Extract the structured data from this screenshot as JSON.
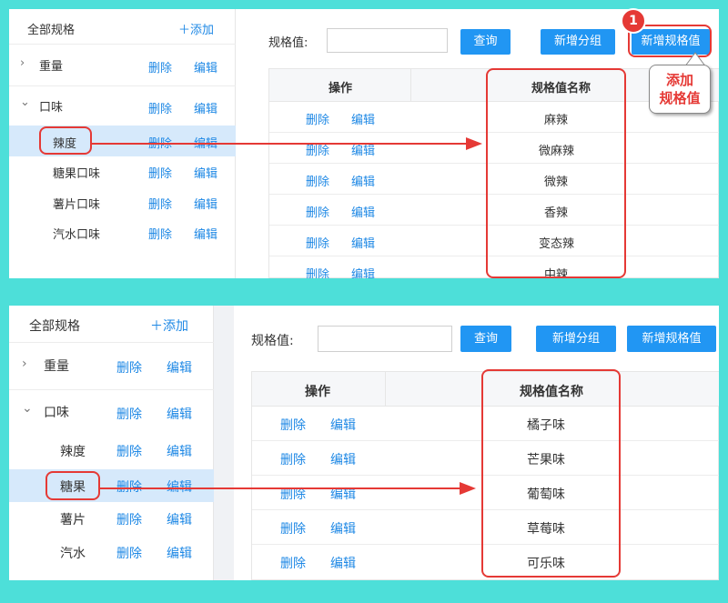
{
  "top": {
    "sidebar": {
      "header": "全部规格",
      "add": "添加",
      "rows": [
        {
          "label": "重量",
          "expand": "›",
          "del": "删除",
          "edit": "编辑"
        },
        {
          "label": "口味",
          "expand": "⌄",
          "del": "删除",
          "edit": "编辑"
        },
        {
          "label": "辣度",
          "del": "删除",
          "edit": "编辑"
        },
        {
          "label": "糖果口味",
          "del": "删除",
          "edit": "编辑"
        },
        {
          "label": "薯片口味",
          "del": "删除",
          "edit": "编辑"
        },
        {
          "label": "汽水口味",
          "del": "删除",
          "edit": "编辑"
        }
      ]
    },
    "toolbar": {
      "label": "规格值:",
      "input_value": "",
      "query": "查询",
      "new_group": "新增分组",
      "new_value": "新增规格值"
    },
    "table": {
      "col_ops": "操作",
      "col_name": "规格值名称",
      "rows": [
        {
          "del": "删除",
          "edit": "编辑",
          "name": "麻辣"
        },
        {
          "del": "删除",
          "edit": "编辑",
          "name": "微麻辣"
        },
        {
          "del": "删除",
          "edit": "编辑",
          "name": "微辣"
        },
        {
          "del": "删除",
          "edit": "编辑",
          "name": "香辣"
        },
        {
          "del": "删除",
          "edit": "编辑",
          "name": "变态辣"
        },
        {
          "del": "删除",
          "edit": "编辑",
          "name": "中辣"
        }
      ]
    },
    "annotation": {
      "badge": "1",
      "callout_line1": "添加",
      "callout_line2": "规格值"
    }
  },
  "bottom": {
    "sidebar": {
      "header": "全部规格",
      "add": "添加",
      "rows": [
        {
          "label": "重量",
          "expand": "›",
          "del": "删除",
          "edit": "编辑"
        },
        {
          "label": "口味",
          "expand": "⌄",
          "del": "删除",
          "edit": "编辑"
        },
        {
          "label": "辣度",
          "del": "删除",
          "edit": "编辑"
        },
        {
          "label": "糖果",
          "del": "删除",
          "edit": "编辑"
        },
        {
          "label": "薯片",
          "del": "删除",
          "edit": "编辑"
        },
        {
          "label": "汽水",
          "del": "删除",
          "edit": "编辑"
        }
      ]
    },
    "toolbar": {
      "label": "规格值:",
      "input_value": "",
      "query": "查询",
      "new_group": "新增分组",
      "new_value": "新增规格值"
    },
    "table": {
      "col_ops": "操作",
      "col_name": "规格值名称",
      "rows": [
        {
          "del": "删除",
          "edit": "编辑",
          "name": "橘子味"
        },
        {
          "del": "删除",
          "edit": "编辑",
          "name": "芒果味"
        },
        {
          "del": "删除",
          "edit": "编辑",
          "name": "葡萄味"
        },
        {
          "del": "删除",
          "edit": "编辑",
          "name": "草莓味"
        },
        {
          "del": "删除",
          "edit": "编辑",
          "name": "可乐味"
        }
      ]
    }
  },
  "colors": {
    "background": "#4ddfd9",
    "accent": "#2196f3",
    "annotation": "#e53935",
    "selected_row": "#d6e9fb"
  },
  "icons": [
    "plus-icon",
    "chevron-right-icon",
    "chevron-down-icon",
    "arrow-icon"
  ]
}
